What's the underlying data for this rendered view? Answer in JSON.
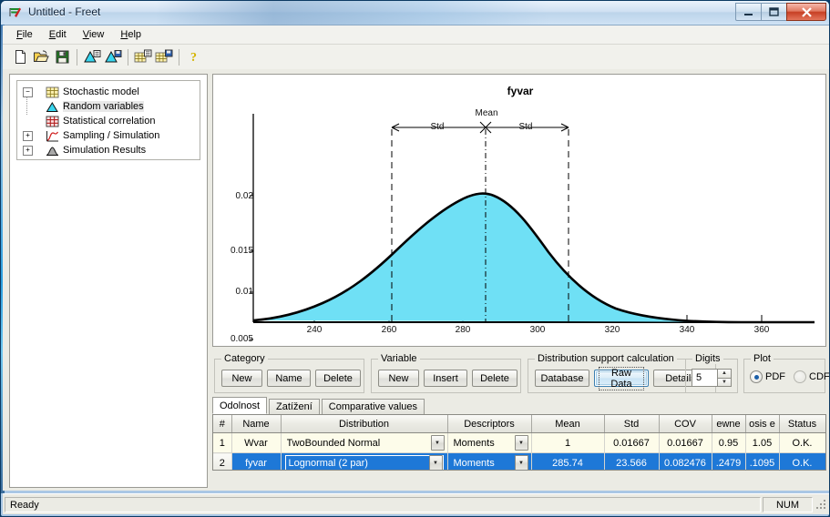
{
  "window": {
    "title": "Untitled - Freet",
    "icon": "freet-app-icon",
    "buttons": {
      "minimize": "–",
      "maximize": "❐",
      "close": "✕"
    }
  },
  "menu": {
    "items": [
      {
        "label": "File",
        "accel": "F"
      },
      {
        "label": "Edit",
        "accel": "E"
      },
      {
        "label": "View",
        "accel": "V"
      },
      {
        "label": "Help",
        "accel": "H"
      }
    ]
  },
  "toolbar": {
    "buttons": [
      {
        "name": "new-icon",
        "tip": "New"
      },
      {
        "name": "open-folder-icon",
        "tip": "Open"
      },
      {
        "name": "save-disk-icon",
        "tip": "Save"
      },
      {
        "name": "random-variables-add-icon",
        "tip": "Add random variable"
      },
      {
        "name": "random-variables-save-icon",
        "tip": "Save random variables"
      },
      {
        "name": "grid-add-icon",
        "tip": "Add grid"
      },
      {
        "name": "grid-save-icon",
        "tip": "Save grid"
      },
      {
        "name": "help-question-icon",
        "tip": "Help"
      }
    ]
  },
  "tree": {
    "nodes": [
      {
        "label": "Stochastic model",
        "expander": "-",
        "icon": "grid-yellow-icon",
        "level": 0,
        "selected": false
      },
      {
        "label": "Random variables",
        "expander": "",
        "icon": "distribution-blue-icon",
        "level": 1,
        "selected": true
      },
      {
        "label": "Statistical correlation",
        "expander": "",
        "icon": "correlation-red-icon",
        "level": 1,
        "selected": false
      },
      {
        "label": "Sampling / Simulation",
        "expander": "+",
        "icon": "sampling-curve-icon",
        "level": 0,
        "selected": false
      },
      {
        "label": "Simulation Results",
        "expander": "+",
        "icon": "results-hill-icon",
        "level": 0,
        "selected": false
      }
    ]
  },
  "chart_data": {
    "type": "area",
    "title": "fyvar",
    "xlabel": "",
    "ylabel": "",
    "xlim": [
      225,
      372
    ],
    "ylim": [
      0,
      0.0215
    ],
    "xticks": [
      240,
      260,
      280,
      300,
      320,
      340,
      360
    ],
    "yticks": [
      0.005,
      0.01,
      0.015,
      0.02
    ],
    "grid": false,
    "legend": "none",
    "fill_color": "#6fe0f5",
    "line_color": "#000000",
    "distribution": "Lognormal (2 par)",
    "mean": 285.74,
    "std": 23.566,
    "annotations": [
      {
        "label": "Mean",
        "x": 285.74
      },
      {
        "label": "Std",
        "x": 274.0
      },
      {
        "label": "Std",
        "x": 297.5
      }
    ],
    "markers": {
      "mean_line_x": 285.74,
      "minus_std_line_x": 262.17,
      "plus_std_line_x": 309.31
    },
    "x": [
      225,
      230,
      235,
      240,
      245,
      250,
      255,
      260,
      265,
      270,
      275,
      280,
      285,
      290,
      295,
      300,
      305,
      310,
      315,
      320,
      325,
      330,
      335,
      340,
      345,
      350,
      355,
      360,
      365,
      372
    ],
    "y": [
      0.00085,
      0.0016,
      0.00275,
      0.00435,
      0.00635,
      0.00865,
      0.011,
      0.0132,
      0.0151,
      0.0164,
      0.01705,
      0.01715,
      0.0168,
      0.016,
      0.0149,
      0.01355,
      0.01205,
      0.01055,
      0.00905,
      0.00765,
      0.0064,
      0.00525,
      0.0043,
      0.00345,
      0.00275,
      0.00218,
      0.0017,
      0.00132,
      0.00102,
      0.00072
    ]
  },
  "options": {
    "category": {
      "title": "Category",
      "buttons": [
        "New",
        "Name",
        "Delete"
      ]
    },
    "variable": {
      "title": "Variable",
      "buttons": [
        "New",
        "Insert",
        "Delete"
      ]
    },
    "distribution_support": {
      "title": "Distribution support calculation",
      "buttons": [
        "Database",
        "Raw Data",
        "Details"
      ],
      "focused": "Raw Data"
    },
    "digits": {
      "title": "Digits",
      "value": "5"
    },
    "plot": {
      "title": "Plot",
      "options": [
        "PDF",
        "CDF"
      ],
      "selected": "PDF"
    }
  },
  "tabs": {
    "items": [
      "Odolnost",
      "Zatížení",
      "Comparative values"
    ],
    "active": "Odolnost"
  },
  "grid": {
    "columns": [
      "#",
      "Name",
      "Distribution",
      "Descriptors",
      "Mean",
      "Std",
      "COV",
      "ewne",
      "osis e",
      "Status"
    ],
    "rows": [
      {
        "index": "1",
        "name": "Wvar",
        "distribution": "TwoBounded Normal",
        "descriptors": "Moments",
        "mean": "1",
        "std": "0.01667",
        "cov": "0.01667",
        "skewness": "0.95",
        "kurtosis": "1.05",
        "status": "O.K.",
        "selected": false
      },
      {
        "index": "2",
        "name": "fyvar",
        "distribution": "Lognormal (2 par)",
        "descriptors": "Moments",
        "mean": "285.74",
        "std": "23.566",
        "cov": "0.082476",
        "skewness": ".2479",
        "kurtosis": ".1095",
        "status": "O.K.",
        "selected": true
      }
    ]
  },
  "statusbar": {
    "message": "Ready",
    "num_indicator": "NUM"
  },
  "colors": {
    "accent": "#1e78d7",
    "chart_fill": "#6fe0f5",
    "titlebar": "#cfe0f2",
    "status_ok": "#2a6a2a"
  }
}
